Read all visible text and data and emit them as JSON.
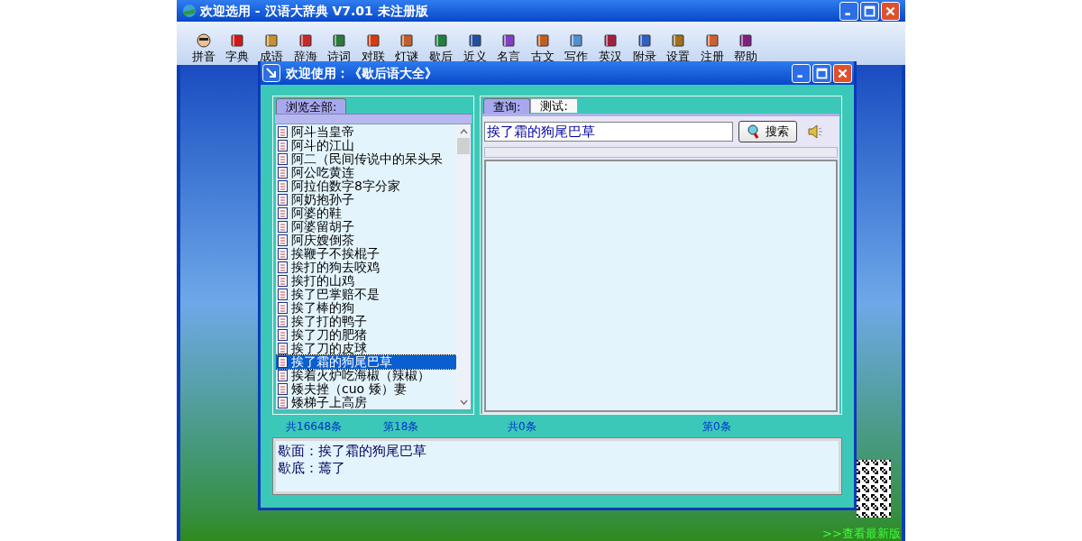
{
  "app_window": {
    "title": "欢迎选用 - 汉语大辞典 V7.01 未注册版"
  },
  "toolbar": [
    "拼音",
    "字典",
    "成语",
    "辞海",
    "诗词",
    "对联",
    "灯谜",
    "歇后",
    "近义",
    "名言",
    "古文",
    "写作",
    "英汉",
    "附录",
    "设置",
    "注册",
    "帮助"
  ],
  "dialog": {
    "title": "欢迎使用：《歇后语大全》"
  },
  "browse_panel": {
    "tabs": [
      {
        "label": "浏览全部:",
        "selected": true
      }
    ],
    "items": [
      {
        "text": "阿斗当皇帝",
        "selected": false
      },
      {
        "text": "阿斗的江山",
        "selected": false
      },
      {
        "text": "阿二（民间传说中的呆头呆",
        "selected": false
      },
      {
        "text": "阿公吃黄连",
        "selected": false
      },
      {
        "text": "阿拉伯数字8字分家",
        "selected": false
      },
      {
        "text": "阿奶抱孙子",
        "selected": false
      },
      {
        "text": "阿婆的鞋",
        "selected": false
      },
      {
        "text": "阿婆留胡子",
        "selected": false
      },
      {
        "text": "阿庆嫂倒茶",
        "selected": false
      },
      {
        "text": "挨鞭子不挨棍子",
        "selected": false
      },
      {
        "text": "挨打的狗去咬鸡",
        "selected": false
      },
      {
        "text": "挨打的山鸡",
        "selected": false
      },
      {
        "text": "挨了巴掌赔不是",
        "selected": false
      },
      {
        "text": "挨了棒的狗",
        "selected": false
      },
      {
        "text": "挨了打的鸭子",
        "selected": false
      },
      {
        "text": "挨了刀的肥猪",
        "selected": false
      },
      {
        "text": "挨了刀的皮球",
        "selected": false
      },
      {
        "text": "挨了霜的狗尾巴草",
        "selected": true
      },
      {
        "text": "挨着火炉吃海椒（辣椒）",
        "selected": false
      },
      {
        "text": "矮夫挫（cuo 矮）妻",
        "selected": false
      },
      {
        "text": "矮梯子上高房",
        "selected": false
      }
    ]
  },
  "query_panel": {
    "tabs": [
      {
        "label": "查询:",
        "selected": true
      },
      {
        "label": "测试:",
        "selected": false
      }
    ],
    "search": {
      "value": "挨了霜的狗尾巴草"
    },
    "search_button": "搜索",
    "progress": {
      "level": 0
    }
  },
  "status": [
    "共16648条",
    "第18条",
    "共0条",
    "第0条"
  ],
  "detail_lines": [
    "歇面：挨了霜的狗尾巴草",
    "歇底：蔫了"
  ],
  "latest_version_link": ">>查看最新版"
}
